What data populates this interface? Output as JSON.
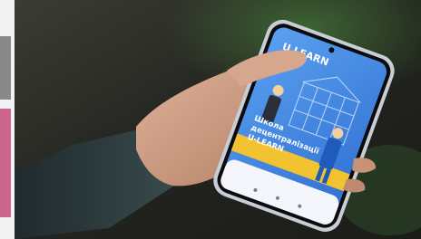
{
  "photo": {
    "subject": "hand holding a smartphone showing an app screen",
    "colors": {
      "background": "#23241f",
      "foliage": "#2f4a2a",
      "sleeve": "#2c3a3c",
      "skin": "#c99a7e",
      "phone_frame": "#b9c2cc",
      "screen_bg": "#4f8fe0",
      "illustration_yellow": "#f2c230",
      "screen_white": "#f4f6fb"
    }
  },
  "screen": {
    "logo_text": "U LEARN",
    "headline": "Школа\nдецентралізації\nU-LEARN"
  }
}
